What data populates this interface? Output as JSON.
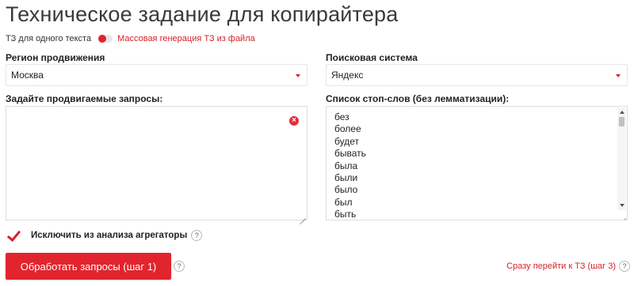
{
  "page": {
    "title": "Техническое задание для копирайтера"
  },
  "mode": {
    "single_label": "ТЗ для одного текста",
    "mass_label": "Массовая генерация ТЗ из файла"
  },
  "region": {
    "label": "Регион продвижения",
    "value": "Москва"
  },
  "search_engine": {
    "label": "Поисковая система",
    "value": "Яндекс"
  },
  "queries": {
    "label": "Задайте продвигаемые запросы:",
    "value": ""
  },
  "stopwords": {
    "label": "Список стоп-слов (без лемматизации):",
    "items": [
      "без",
      "более",
      "будет",
      "бывать",
      "была",
      "были",
      "было",
      "был",
      "быть"
    ]
  },
  "aggregators": {
    "label": "Исключить из анализа агрегаторы",
    "checked": true
  },
  "actions": {
    "process_label": "Обработать запросы (шаг 1)",
    "skip_label": "Сразу перейти к ТЗ (шаг 3)",
    "help_glyph": "?"
  },
  "colors": {
    "accent": "#e2242e",
    "text": "#222222"
  }
}
